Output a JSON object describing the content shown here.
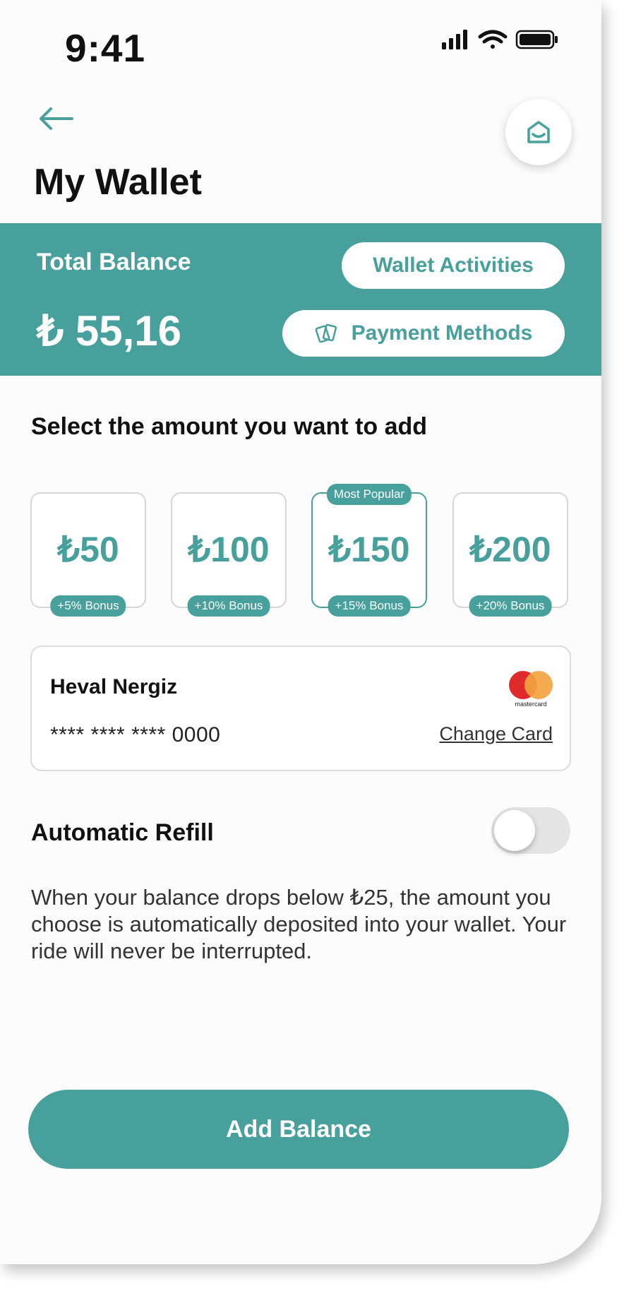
{
  "status_bar": {
    "time": "9:41"
  },
  "header": {
    "title": "My Wallet"
  },
  "balance": {
    "label": "Total Balance",
    "value": "₺ 55,16",
    "wallet_activities_label": "Wallet Activities",
    "payment_methods_label": "Payment Methods"
  },
  "amounts": {
    "title": "Select the amount you want to add",
    "popular_label": "Most Popular",
    "options": [
      {
        "value": "₺50",
        "bonus": "+5% Bonus"
      },
      {
        "value": "₺100",
        "bonus": "+10% Bonus"
      },
      {
        "value": "₺150",
        "bonus": "+15% Bonus"
      },
      {
        "value": "₺200",
        "bonus": "+20% Bonus"
      }
    ],
    "selected_index": 2
  },
  "card": {
    "holder": "Heval Nergiz",
    "number": "**** **** **** 0000",
    "change_label": "Change Card",
    "brand_label": "mastercard"
  },
  "refill": {
    "title": "Automatic Refill",
    "enabled": false,
    "description": "When your balance drops below ₺25, the amount you choose is automatically deposited into your wallet. Your ride will never be interrupted."
  },
  "cta": {
    "label": "Add Balance"
  },
  "colors": {
    "accent": "#47a09b",
    "mastercard_red": "#e12a2c",
    "mastercard_orange": "#f3a33f"
  }
}
